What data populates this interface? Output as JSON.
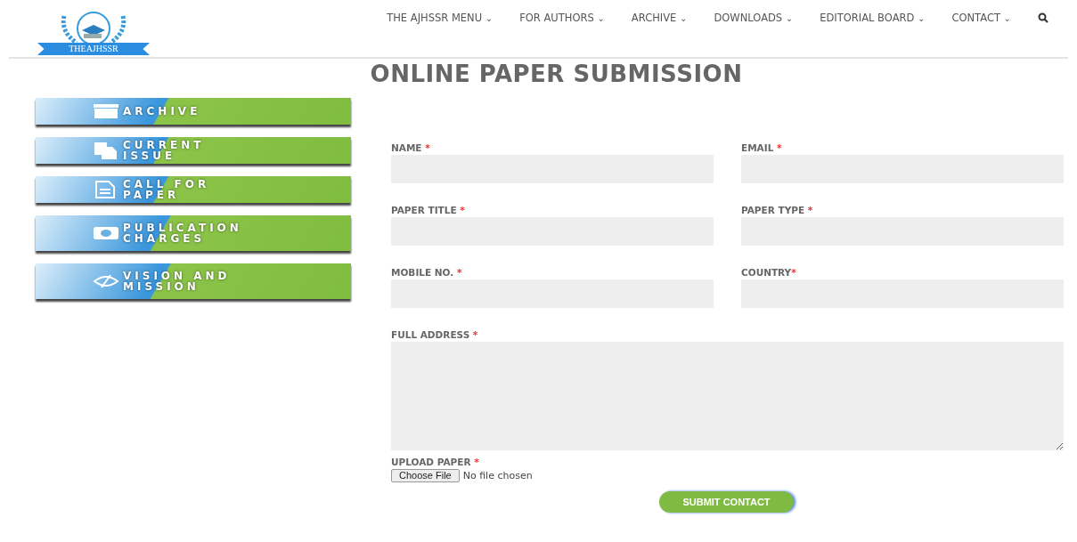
{
  "logo": {
    "text": "THEAJHSSR"
  },
  "nav": [
    {
      "label": "THE AJHSSR MENU",
      "caret": "⌄"
    },
    {
      "label": "FOR AUTHORS",
      "caret": "⌄"
    },
    {
      "label": "ARCHIVE",
      "caret": "⌄"
    },
    {
      "label": "DOWNLOADS",
      "caret": "⌄"
    },
    {
      "label": "EDITORIAL BOARD",
      "caret": "⌄"
    },
    {
      "label": "CONTACT",
      "caret": "⌄"
    }
  ],
  "title": "ONLINE PAPER SUBMISSION",
  "sidebar": [
    {
      "label": "ARCHIVE",
      "kind": "archive"
    },
    {
      "label": "CURRENT ISSUE",
      "kind": "issue"
    },
    {
      "label": "CALL FOR PAPER",
      "kind": "paper"
    },
    {
      "label": "PUBLICATION CHARGES",
      "kind": "charges"
    },
    {
      "label": "VISION AND MISSION",
      "kind": "vision"
    }
  ],
  "form": {
    "fields": [
      {
        "label": "NAME",
        "mark": " *",
        "kind": "text"
      },
      {
        "label": "EMAIL",
        "mark": " *",
        "kind": "text"
      },
      {
        "label": "PAPER TITLE",
        "mark": " *",
        "kind": "text"
      },
      {
        "label": "PAPER TYPE",
        "mark": " *",
        "kind": "text"
      },
      {
        "label": "MOBILE NO.",
        "mark": " *",
        "kind": "text"
      },
      {
        "label": "COUNTRY",
        "mark": "*",
        "kind": "text"
      },
      {
        "label": "FULL ADDRESS",
        "mark": " *",
        "kind": "textarea"
      },
      {
        "label": "UPLOAD PAPER",
        "mark": " *",
        "kind": "file",
        "button": "Choose File",
        "status": "No file chosen"
      }
    ],
    "submit": "SUBMIT CONTACT"
  }
}
